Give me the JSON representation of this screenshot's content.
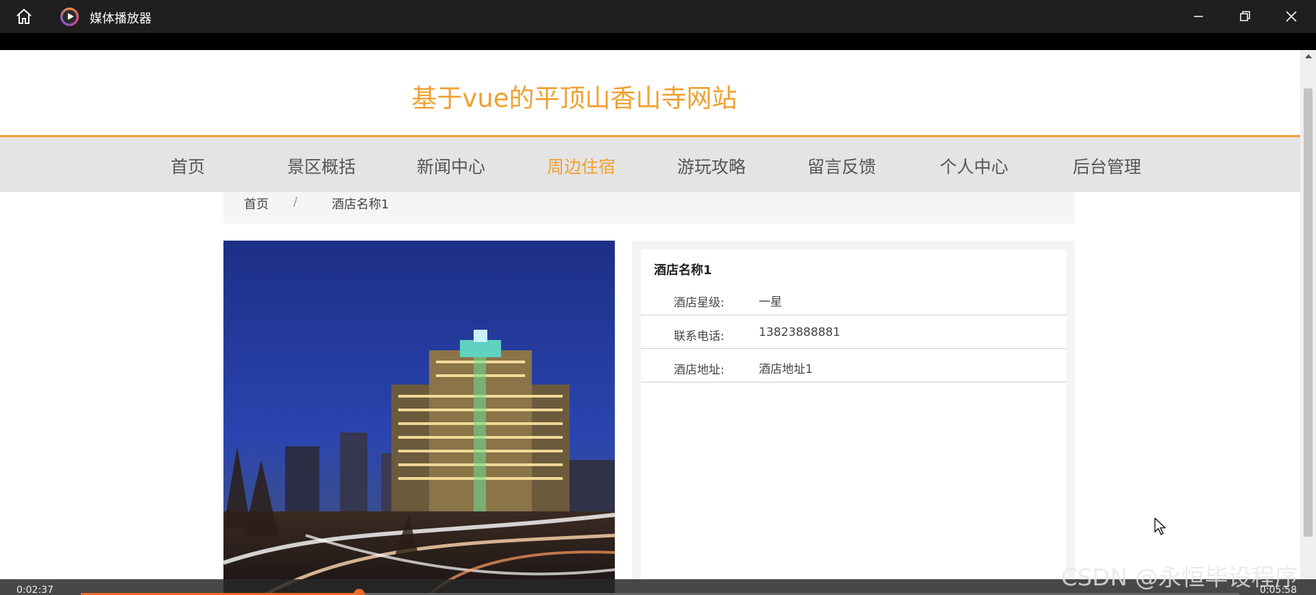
{
  "player": {
    "title": "媒体播放器",
    "time_elapsed": "0:02:37",
    "time_total": "0:05:58",
    "progress_fraction": 0.24,
    "accent": "#f06a28"
  },
  "site": {
    "title": "基于vue的平顶山香山寺网站",
    "accent": "#f0a030"
  },
  "nav": {
    "items": [
      {
        "label": "首页"
      },
      {
        "label": "景区概括"
      },
      {
        "label": "新闻中心"
      },
      {
        "label": "周边住宿",
        "active": true
      },
      {
        "label": "游玩攻略"
      },
      {
        "label": "留言反馈"
      },
      {
        "label": "个人中心"
      },
      {
        "label": "后台管理"
      }
    ]
  },
  "breadcrumb": {
    "home": "首页",
    "separator": "/",
    "current": "酒店名称1"
  },
  "hotel": {
    "name": "酒店名称1",
    "fields": [
      {
        "label": "酒店星级:",
        "value": "一星"
      },
      {
        "label": "联系电话:",
        "value": "13823888881"
      },
      {
        "label": "酒店地址:",
        "value": "酒店地址1"
      }
    ]
  },
  "watermark": "CSDN @永恒毕设程序"
}
